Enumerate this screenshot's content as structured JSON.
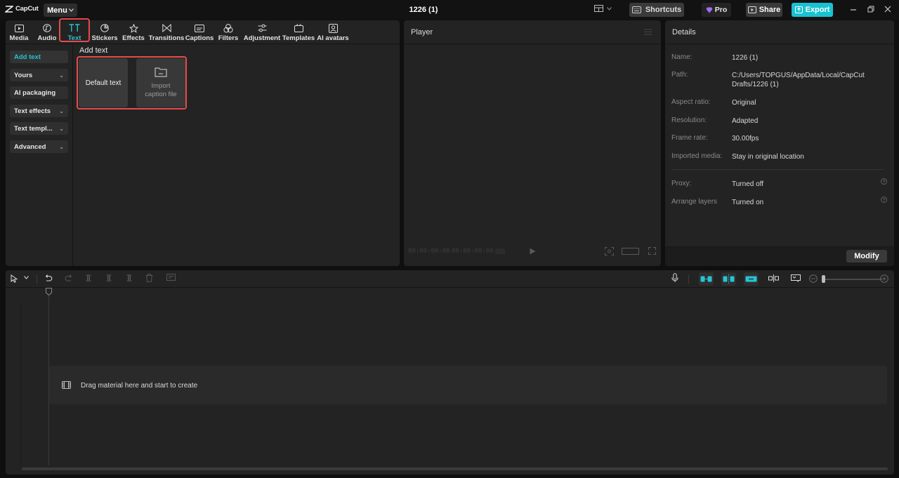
{
  "titlebar": {
    "app_name": "CapCut",
    "menu_label": "Menu",
    "project_title": "1226 (1)",
    "shortcuts_label": "Shortcuts",
    "pro_label": "Pro",
    "share_label": "Share",
    "export_label": "Export"
  },
  "toolbar": {
    "tabs": [
      {
        "label": "Media",
        "icon": "media-icon"
      },
      {
        "label": "Audio",
        "icon": "audio-icon"
      },
      {
        "label": "Text",
        "icon": "text-icon",
        "active": true
      },
      {
        "label": "Stickers",
        "icon": "stickers-icon"
      },
      {
        "label": "Effects",
        "icon": "effects-icon"
      },
      {
        "label": "Transitions",
        "icon": "transitions-icon"
      },
      {
        "label": "Captions",
        "icon": "captions-icon"
      },
      {
        "label": "Filters",
        "icon": "filters-icon"
      },
      {
        "label": "Adjustment",
        "icon": "adjustment-icon"
      },
      {
        "label": "Templates",
        "icon": "templates-icon"
      },
      {
        "label": "AI avatars",
        "icon": "ai-avatars-icon"
      }
    ]
  },
  "sidebar": {
    "items": [
      {
        "label": "Add text",
        "active": true
      },
      {
        "label": "Yours",
        "has_dropdown": true
      },
      {
        "label": "AI packaging"
      },
      {
        "label": "Text effects",
        "has_dropdown": true
      },
      {
        "label": "Text templ...",
        "has_dropdown": true
      },
      {
        "label": "Advanced",
        "has_dropdown": true
      }
    ]
  },
  "content": {
    "title": "Add text",
    "default_card": "Default text",
    "import_card_line1": "Import",
    "import_card_line2": "caption file"
  },
  "player": {
    "title": "Player",
    "current_time": "00:00:00:00",
    "total_time": "00:00:00:00"
  },
  "details": {
    "title": "Details",
    "rows": [
      {
        "key": "Name:",
        "value": "1226 (1)"
      },
      {
        "key": "Path:",
        "value": "C:/Users/TOPGUS/AppData/Local/CapCut Drafts/1226 (1)"
      },
      {
        "key": "Aspect ratio:",
        "value": "Original"
      },
      {
        "key": "Resolution:",
        "value": "Adapted"
      },
      {
        "key": "Frame rate:",
        "value": "30.00fps"
      },
      {
        "key": "Imported media:",
        "value": "Stay in original location"
      }
    ],
    "extra_rows": [
      {
        "key": "Proxy:",
        "value": "Turned off"
      },
      {
        "key": "Arrange layers",
        "value": "Turned on"
      }
    ],
    "modify_label": "Modify"
  },
  "timeline": {
    "drop_hint": "Drag material here and start to create"
  },
  "colors": {
    "accent": "#25c4d3",
    "export": "#19c2d0",
    "highlight": "#e84a4a"
  }
}
